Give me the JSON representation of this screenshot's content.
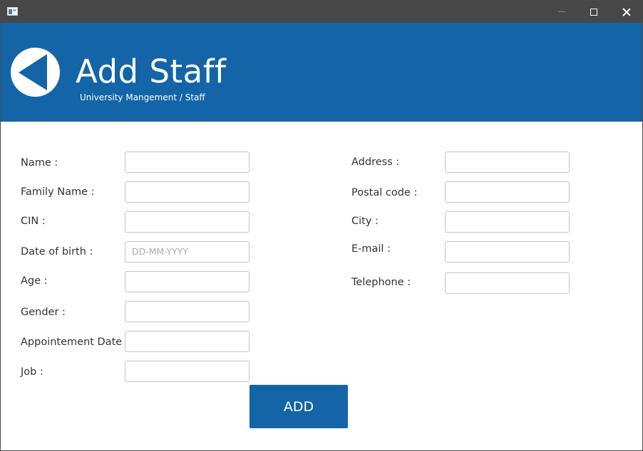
{
  "window": {
    "icon": "app-window-icon",
    "controls": {
      "minimize": "minimize-icon",
      "maximize": "maximize-icon",
      "close": "close-icon"
    }
  },
  "header": {
    "title": "Add Staff",
    "breadcrumb": "University Mangement / Staff",
    "back_icon": "back-arrow-icon",
    "background_color": "#1365a7"
  },
  "form": {
    "left": {
      "name": {
        "label": "Name :",
        "value": "",
        "placeholder": ""
      },
      "family_name": {
        "label": "Family Name :",
        "value": "",
        "placeholder": ""
      },
      "cin": {
        "label": "CIN :",
        "value": "",
        "placeholder": ""
      },
      "date_of_birth": {
        "label": "Date of birth :",
        "value": "",
        "placeholder": "DD-MM-YYYY"
      },
      "age": {
        "label": "Age :",
        "value": "",
        "placeholder": ""
      },
      "gender": {
        "label": "Gender :",
        "value": "",
        "placeholder": ""
      },
      "appointment_date": {
        "label": "Appointement Date :",
        "value": "",
        "placeholder": ""
      },
      "job": {
        "label": "Job :",
        "value": "",
        "placeholder": ""
      }
    },
    "right": {
      "address": {
        "label": "Address :",
        "value": "",
        "placeholder": ""
      },
      "postal_code": {
        "label": "Postal code :",
        "value": "",
        "placeholder": ""
      },
      "city": {
        "label": "City :",
        "value": "",
        "placeholder": ""
      },
      "email": {
        "label": "E-mail :",
        "value": "",
        "placeholder": ""
      },
      "telephone": {
        "label": "Telephone :",
        "value": "",
        "placeholder": ""
      }
    },
    "submit_label": "ADD"
  }
}
